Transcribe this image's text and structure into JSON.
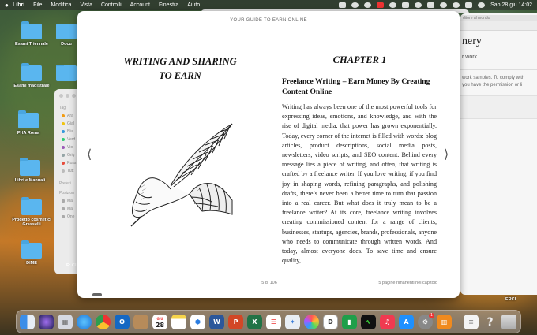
{
  "menubar": {
    "items": [
      "Libri",
      "File",
      "Modifica",
      "Vista",
      "Controlli",
      "Account",
      "Finestra",
      "Aiuto"
    ],
    "clock": "Sab 28 giu  14:02"
  },
  "desktop": {
    "icons": [
      "Esami Triennale",
      "Esami magistrale",
      "PHA Roma",
      "Libri e Manuali",
      "Progetto cosmetici Grasselli",
      "DIME"
    ],
    "partial_labels": [
      "Docu",
      "E: Cl",
      "ERCI"
    ]
  },
  "finder": {
    "section_tags": "Tag",
    "tags": [
      "Ara",
      "Gial",
      "Blu",
      "Verd",
      "Viol",
      "Grig",
      "Ross",
      "Tutt"
    ],
    "section_prefs": "Preferi",
    "section_positions": "Posizion",
    "positions": [
      "Ma",
      "Ma",
      "One"
    ]
  },
  "rightwin": {
    "tab": "ditore al mondo",
    "heading": "nery",
    "line1": "r work.",
    "line2": "work samples. To comply with",
    "line3": "you have the permission or li"
  },
  "book": {
    "header": "YOUR GUIDE TO EARN ONLINE",
    "left_title": "WRITING AND SHARING TO EARN",
    "chapter": "CHAPTER 1",
    "subtitle": "Freelance Writing – Earn Money By Creating Content Online",
    "body": "Writing has always been one of the most powerful tools for expressing ideas, emotions, and knowledge, and with the rise of digital media, that power has grown exponentially. Today, every corner of the internet is filled with words: blog articles, product descriptions, social media posts, newsletters, video scripts, and SEO content. Behind every message lies a piece of writing, and often, that writing is crafted by a freelance writer. If you love writing, if you find joy in shaping words, refining paragraphs, and polishing drafts, there’s never been a better time to turn that passion into a real career. But what does it truly mean to be a freelance writer? At its core, freelance writing involves creating commissioned content for a range of clients, businesses, startups, agencies, brands, professionals, anyone who needs to communicate through written words. And today, almost everyone does. To save time and ensure quality,",
    "page": "5 di 106",
    "remaining": "5 pagine rimanenti nel capitolo",
    "prev": "⟨",
    "next": "⟩"
  },
  "dock": {
    "calendar_month": "GIU",
    "calendar_day": "28",
    "mail_badge": "1",
    "apps": [
      "Finder",
      "Siri",
      "Launchpad",
      "Safari",
      "Chrome",
      "Outlook",
      "Notes",
      "Calendar",
      "Word",
      "PowerPoint",
      "Excel",
      "Reminders",
      "Preview",
      "Photos",
      "Dictionary",
      "Numbers",
      "Activity Monitor",
      "Music",
      "App Store",
      "System Settings",
      "Books",
      "Document",
      "Help",
      "Trash"
    ]
  }
}
